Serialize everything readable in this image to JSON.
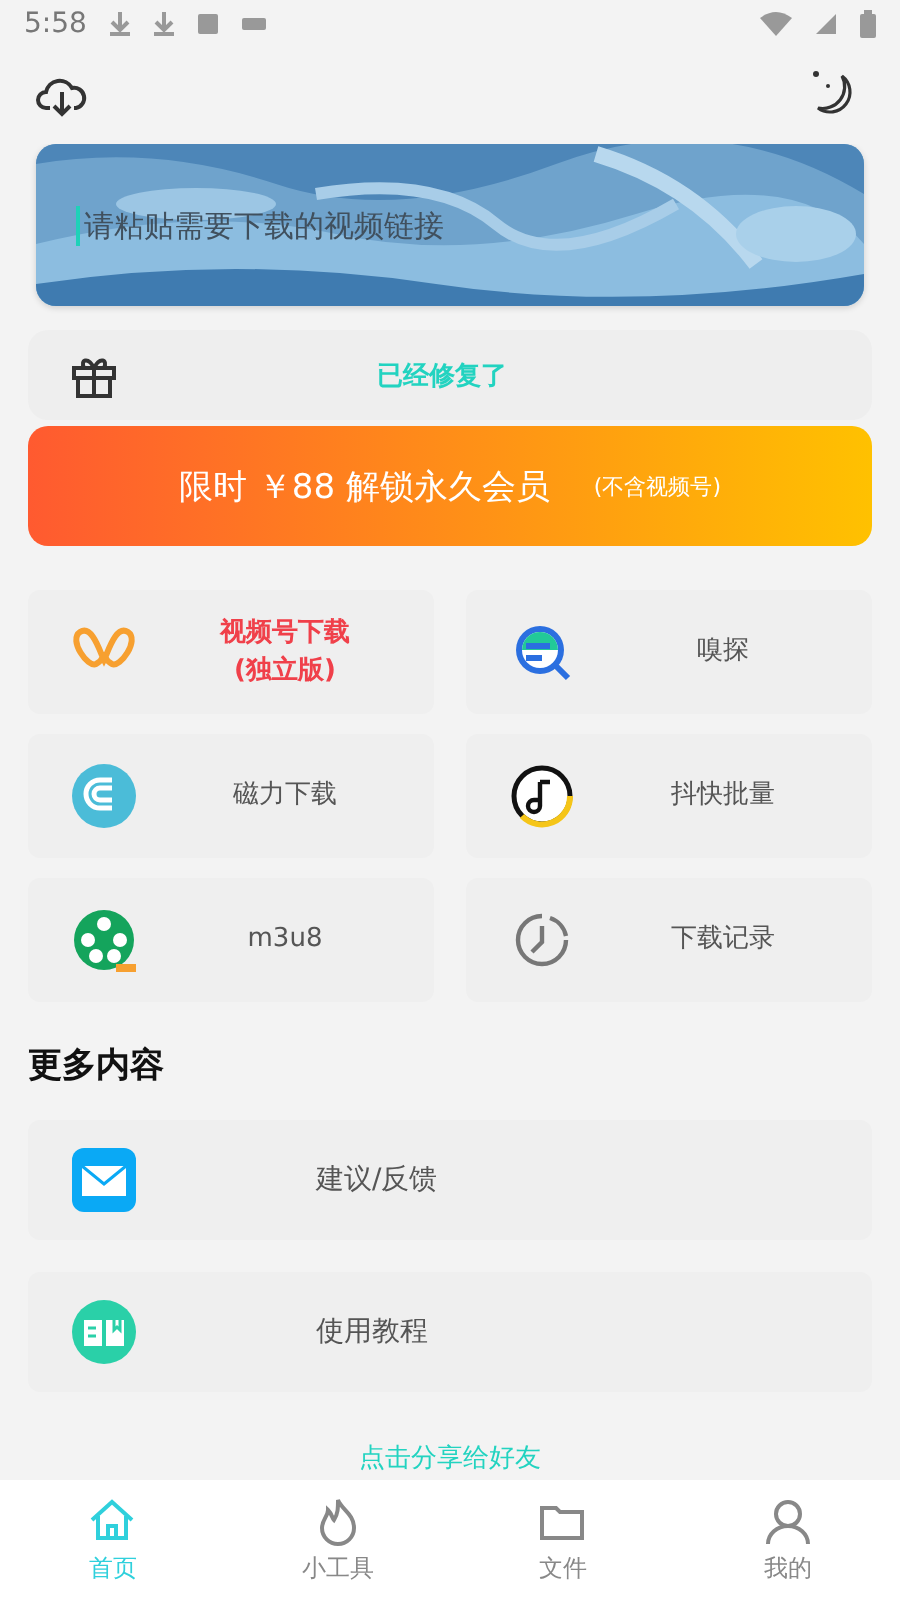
{
  "status_bar": {
    "time": "5:58"
  },
  "link_field": {
    "placeholder": "请粘贴需要下载的视频链接"
  },
  "notice": {
    "text": "已经修复了"
  },
  "promo": {
    "main": "限时 ￥88 解锁永久会员",
    "note": "(不含视频号)"
  },
  "tools": [
    {
      "kind": "butterfly",
      "label": "视频号下载\n(独立版)",
      "highlight": true
    },
    {
      "kind": "sniff",
      "label": "嗅探",
      "highlight": false
    },
    {
      "kind": "magnet",
      "label": "磁力下载",
      "highlight": false
    },
    {
      "kind": "music",
      "label": "抖快批量",
      "highlight": false
    },
    {
      "kind": "film",
      "label": "m3u8",
      "highlight": false
    },
    {
      "kind": "clock",
      "label": "下载记录",
      "highlight": false
    }
  ],
  "more": {
    "title": "更多内容",
    "items": [
      {
        "kind": "mail",
        "label": "建议/反馈"
      },
      {
        "kind": "book",
        "label": "使用教程"
      }
    ]
  },
  "share": {
    "text": "点击分享给好友"
  },
  "nav": [
    {
      "kind": "home",
      "label": "首页",
      "selected": true
    },
    {
      "kind": "flame",
      "label": "小工具",
      "selected": false
    },
    {
      "kind": "folder",
      "label": "文件",
      "selected": false
    },
    {
      "kind": "person",
      "label": "我的",
      "selected": false
    }
  ]
}
